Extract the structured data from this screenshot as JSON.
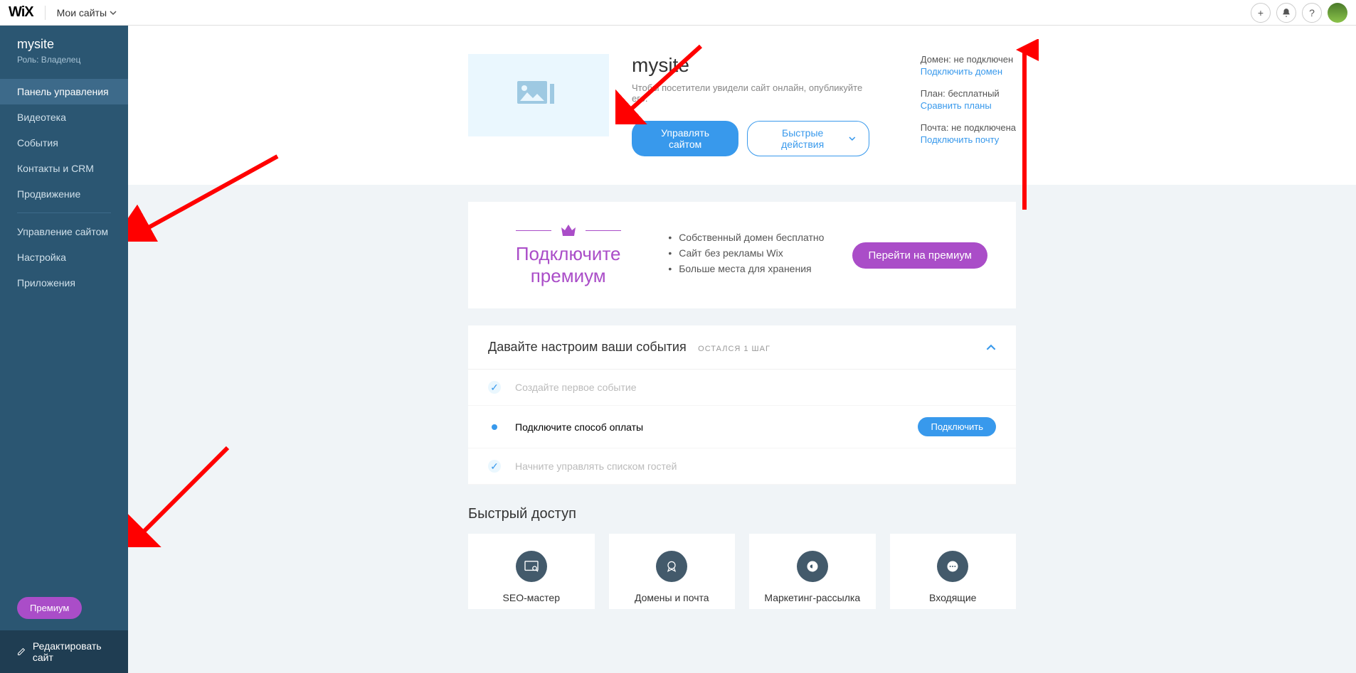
{
  "topbar": {
    "logo": "WiX",
    "my_sites": "Мои сайты"
  },
  "sidebar": {
    "site_name": "mysite",
    "role": "Роль: Владелец",
    "nav": [
      "Панель управления",
      "Видеотека",
      "События",
      "Контакты и CRM",
      "Продвижение"
    ],
    "nav2": [
      "Управление сайтом",
      "Настройка",
      "Приложения"
    ],
    "premium": "Премиум",
    "edit_site": "Редактировать сайт"
  },
  "hero": {
    "title": "mysite",
    "subtitle": "Чтобы посетители увидели сайт онлайн, опубликуйте его.",
    "manage_btn": "Управлять сайтом",
    "quick_btn": "Быстрые действия",
    "meta": {
      "domain_label": "Домен: не подключен",
      "domain_link": "Подключить домен",
      "plan_label": "План: бесплатный",
      "plan_link": "Сравнить планы",
      "mail_label": "Почта: не подключена",
      "mail_link": "Подключить почту"
    }
  },
  "premium_banner": {
    "title": "Подключите премиум",
    "benefits": [
      "Собственный домен бесплатно",
      "Сайт без рекламы Wix",
      "Больше места для хранения"
    ],
    "cta": "Перейти на премиум"
  },
  "setup": {
    "title": "Давайте настроим ваши события",
    "remaining": "ОСТАЛСЯ 1 ШАГ",
    "steps": [
      {
        "text": "Создайте первое событие",
        "done": true
      },
      {
        "text": "Подключите способ оплаты",
        "done": false,
        "btn": "Подключить"
      },
      {
        "text": "Начните управлять списком гостей",
        "done": true
      }
    ]
  },
  "quick": {
    "title": "Быстрый доступ",
    "cards": [
      "SEO-мастер",
      "Домены и почта",
      "Маркетинг-рассылка",
      "Входящие"
    ]
  }
}
